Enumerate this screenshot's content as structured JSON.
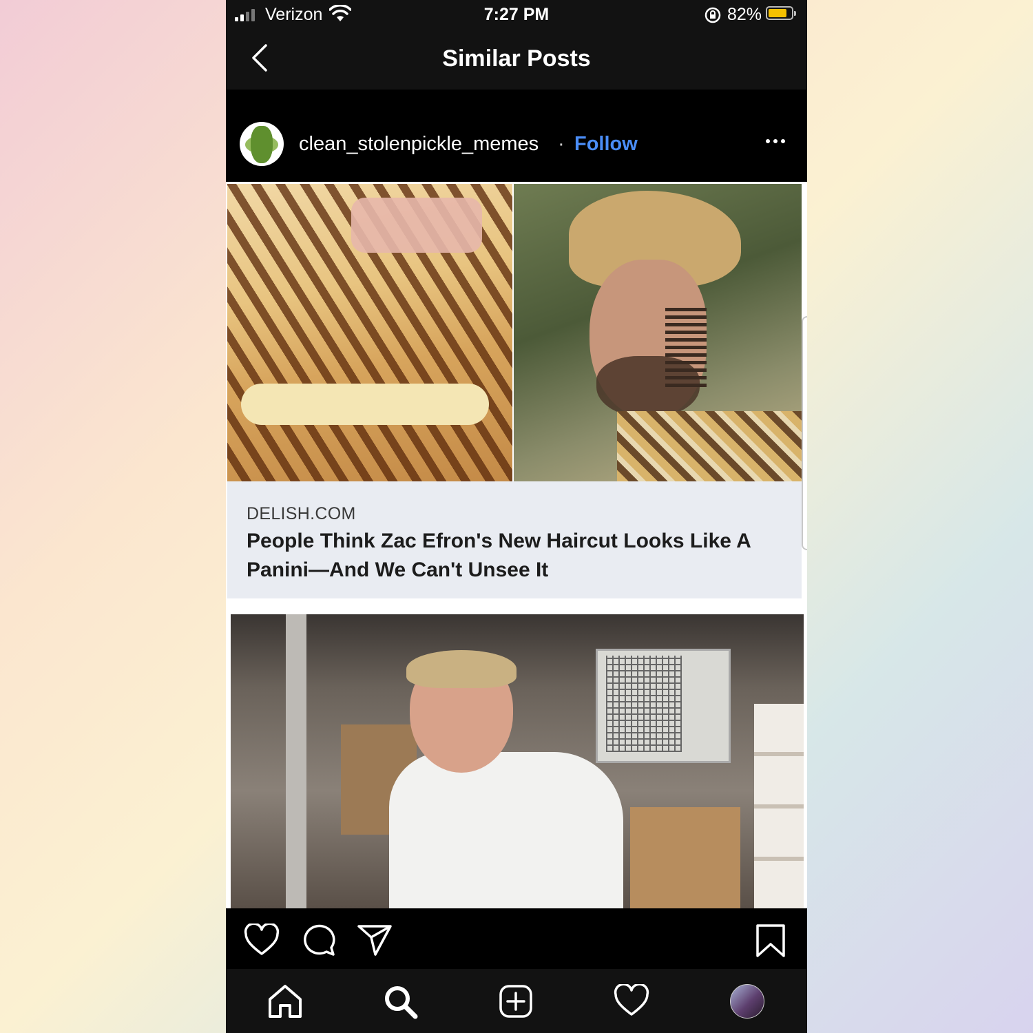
{
  "status_bar": {
    "carrier": "Verizon",
    "time": "7:27 PM",
    "battery_percent": "82%",
    "battery_level": 0.82,
    "icons": [
      "signal-icon",
      "wifi-icon",
      "rotation-lock-icon",
      "battery-icon"
    ]
  },
  "header": {
    "title": "Similar Posts",
    "back_icon": "chevron-left-icon"
  },
  "post": {
    "username": "clean_stolenpickle_memes",
    "separator": "·",
    "follow_label": "Follow",
    "more_icon": "more-horizontal-icon",
    "link_card": {
      "domain": "DELISH.COM",
      "headline": "People Think Zac Efron's New Haircut Looks Like A Panini—And We Can't Unsee It"
    },
    "actions": [
      "heart-icon",
      "comment-icon",
      "share-icon",
      "bookmark-icon"
    ]
  },
  "tab_bar": {
    "items": [
      "home-icon",
      "search-icon",
      "new-post-icon",
      "activity-icon",
      "profile-avatar"
    ]
  },
  "colors": {
    "follow_link": "#4a8df7",
    "background": "#000000",
    "header_bg": "#121212",
    "link_card_bg": "#e9ecf2"
  }
}
